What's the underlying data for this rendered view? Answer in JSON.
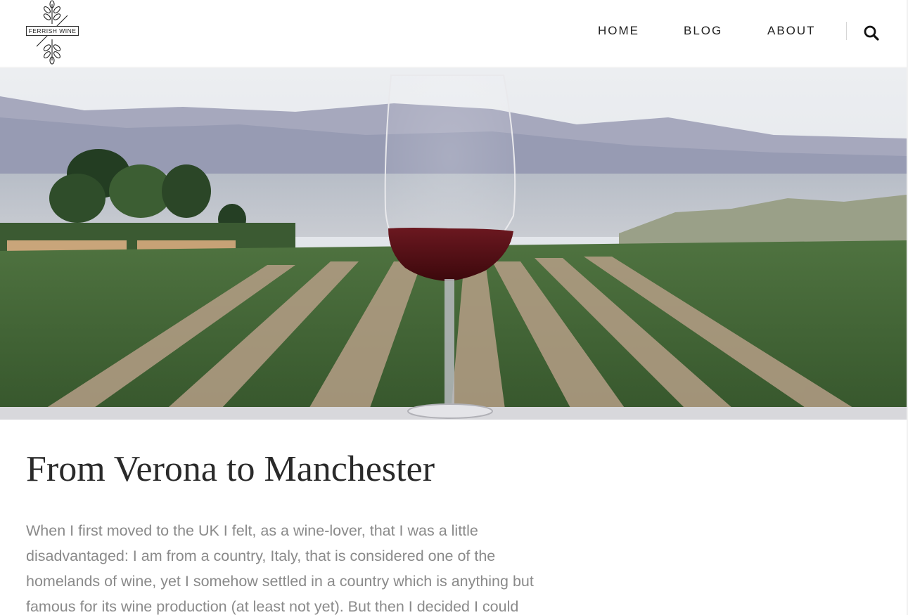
{
  "brand": {
    "logo_text": "FERRISH WINE"
  },
  "nav": {
    "items": [
      {
        "label": "HOME"
      },
      {
        "label": "BLOG"
      },
      {
        "label": "ABOUT"
      }
    ],
    "search_icon": "search-icon"
  },
  "hero": {
    "image": "wine-glass-vineyard-photo"
  },
  "article": {
    "title": "From Verona to Manchester",
    "body_lines": [
      "When I first moved to the UK I felt, as a wine-lover, that I was a little",
      "disadvantaged: I am from a country, Italy, that is considered one of the",
      "homelands of wine, yet I somehow settled in a country which is anything but",
      "famous for its wine production (at least not yet). But then I decided I could"
    ]
  },
  "colors": {
    "title": "#2a2a2a",
    "body_text": "#8a8a8a",
    "nav_text": "#222222",
    "wine": "#5a0f14"
  }
}
